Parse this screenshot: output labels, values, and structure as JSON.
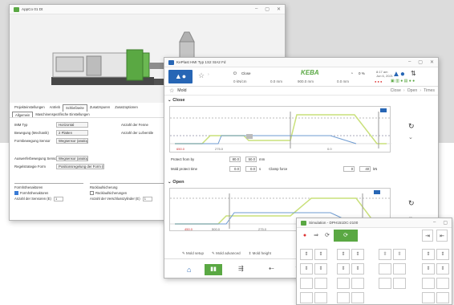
{
  "window1": {
    "title": "AppCo 01 Dt",
    "tabs": [
      "Projekteinstellungen",
      "Antrieb",
      "Schließseite",
      "Zusatzspuren",
      "Zusatzoptionen"
    ],
    "active_tab": "Schließseite",
    "subtabs": [
      "Allgemein",
      "Maschinenspezifische Einstellungen"
    ],
    "fields": [
      {
        "label": "IMM Typ",
        "value": "Horizontal"
      },
      {
        "label": "Bewegung (Mechanik)",
        "value": "2 Platten"
      },
      {
        "label": "Formbewegung Sensor",
        "value": "Wegsensor (analog)"
      }
    ],
    "fields_right": [
      {
        "label": "Anzahl der Fenne",
        "value": ""
      },
      {
        "label": "Anzahl der Lufventile",
        "value": ""
      }
    ],
    "fields2": [
      {
        "label": "Auswerferbewegung Sensor",
        "value": "Wegsensor (analog)"
      },
      {
        "label": "Regelstrategie Form",
        "value": "Positionsregelung der Form (E)"
      }
    ],
    "group_left": {
      "title": "Formhöhenaktoren",
      "check": "Formhöhenaktoren",
      "count_label": "Anzahl der Sensoren (E)",
      "count": "1"
    },
    "group_right": {
      "title": "Rücklaufsicherung",
      "check": "Rücklaufsicherungen",
      "count_label": "Anzahl der Verschlusszylinder (E)",
      "count": "1"
    }
  },
  "window2": {
    "title": "KePlast HMI Typ 1S2 StA2 Fd",
    "brand": "KEBA",
    "status": [
      "Close",
      "0 %",
      "0 kN/cm",
      "0.0 mm",
      "900.0 mm",
      "0.0 mm"
    ],
    "clock": "8:17 am\nJun 6, 2021",
    "nav_title": "Mold",
    "nav_links": [
      "Close",
      "Open",
      "Times"
    ],
    "sections": [
      "Close",
      "Open"
    ],
    "close_rows": [
      {
        "label": "Protect from by",
        "value": "80.0",
        "value2": "50.0",
        "unit": "mm"
      },
      {
        "label": "Mold protect time",
        "value": "0.0",
        "value2": "0.0",
        "unit": "s",
        "label2": "Clamp force",
        "value3": "0",
        "value4": "40",
        "unit2": "kN"
      }
    ],
    "close_axis": [
      "650.0",
      "275.0",
      "0.0"
    ],
    "open_axis": [
      "450.0",
      "500.0",
      "275.0"
    ],
    "footer_links": [
      "Mold setup",
      "Mold advanced",
      "Mold height"
    ]
  },
  "window3": {
    "title": "Simulation - DPH151DC-2100",
    "grid_glyphs": [
      "⇕",
      "⇕",
      "⇕",
      "⇕",
      "⇳",
      "⇳",
      "⇕",
      "⇕",
      "⇕",
      "⇕",
      "⇕",
      "⇕",
      "⇕",
      "⇕"
    ]
  },
  "colors": {
    "keba_blue": "#2766b5",
    "green": "#5aa843",
    "line_green": "#c9e07a"
  }
}
